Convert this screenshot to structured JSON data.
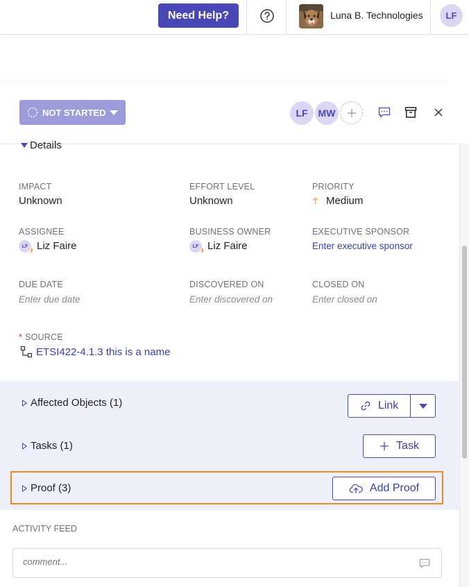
{
  "topbar": {
    "help_label": "Need Help?",
    "org_name": "Luna B. Technologies",
    "user_initials": "LF"
  },
  "header": {
    "status_label": "NOT STARTED",
    "assignees": [
      "LF",
      "MW"
    ]
  },
  "details": {
    "toggle_label": "Details",
    "impact": {
      "label": "IMPACT",
      "value": "Unknown"
    },
    "effort": {
      "label": "EFFORT LEVEL",
      "value": "Unknown"
    },
    "priority": {
      "label": "PRIORITY",
      "value": "Medium"
    },
    "assignee": {
      "label": "ASSIGNEE",
      "value": "Liz Faire",
      "initials": "LF"
    },
    "business_owner": {
      "label": "BUSINESS OWNER",
      "value": "Liz Faire",
      "initials": "LF"
    },
    "executive_sponsor": {
      "label": "EXECUTIVE SPONSOR",
      "placeholder": "Enter executive sponsor"
    },
    "due_date": {
      "label": "DUE DATE",
      "placeholder": "Enter due date"
    },
    "discovered_on": {
      "label": "DISCOVERED ON",
      "placeholder": "Enter discovered on"
    },
    "closed_on": {
      "label": "CLOSED ON",
      "placeholder": "Enter closed on"
    },
    "source": {
      "required_mark": "*",
      "label": "SOURCE",
      "value": "ETSI422-4.1.3 this is a name"
    }
  },
  "sections": {
    "affected_objects": {
      "title": "Affected Objects (1)",
      "button": "Link"
    },
    "tasks": {
      "title": "Tasks (1)",
      "button": "Task"
    },
    "proof": {
      "title": "Proof (3)",
      "button": "Add Proof"
    }
  },
  "activity": {
    "label": "ACTIVITY FEED",
    "comment_placeholder": "comment..."
  },
  "colors": {
    "accent": "#4a47b6",
    "status_bg": "#9d9bd9",
    "highlight": "#ee8a1e",
    "priority_arrow": "#f0a04a"
  }
}
